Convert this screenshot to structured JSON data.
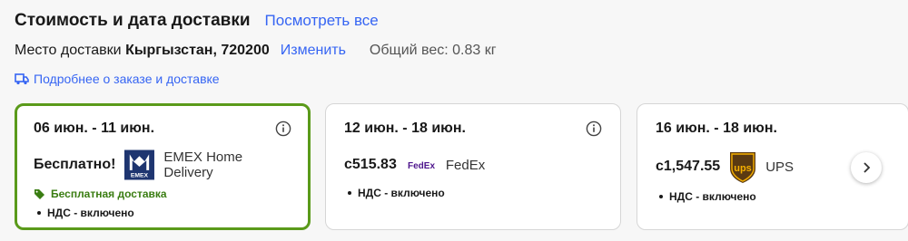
{
  "header": {
    "title": "Стоимость и дата доставки",
    "see_all": "Посмотреть все"
  },
  "location": {
    "label": "Место доставки",
    "value": "Кыргызстан, 720200",
    "change": "Изменить",
    "weight": "Общий вес: 0.83 кг"
  },
  "details_link": "Подробнее о заказе и доставке",
  "colors": {
    "link": "#3665f3",
    "selected_border": "#5a9a1a",
    "free_text": "#3a7d12"
  },
  "cards": [
    {
      "date": "06 июн. - 11 июн.",
      "price": "Бесплатно!",
      "carrier": "EMEX Home Delivery",
      "logo_text": "EMEX",
      "free_note": "Бесплатная доставка",
      "vat": "НДС - включено",
      "selected": true
    },
    {
      "date": "12 июн. - 18 июн.",
      "price": "c515.83",
      "carrier": "FedEx",
      "logo_text": "FedEx",
      "vat": "НДС - включено",
      "selected": false
    },
    {
      "date": "16 июн. - 18 июн.",
      "price": "c1,547.55",
      "carrier": "UPS",
      "logo_text": "ups",
      "vat": "НДС - включено",
      "selected": false
    }
  ]
}
